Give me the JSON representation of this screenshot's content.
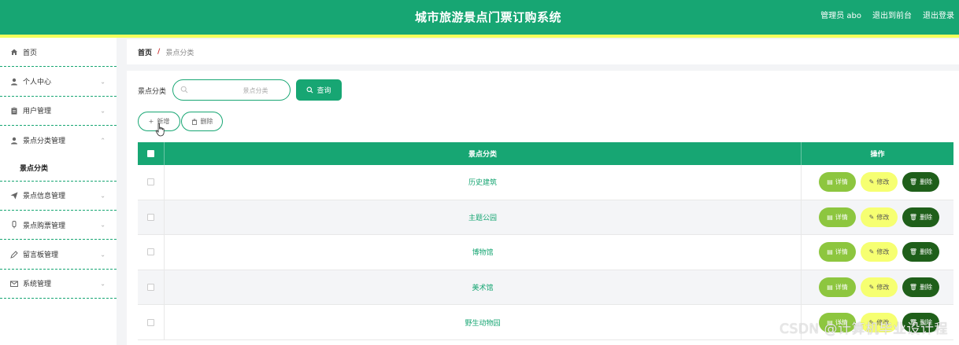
{
  "header": {
    "title": "城市旅游景点门票订购系统",
    "admin": "管理员 abo",
    "back_to_front": "退出到前台",
    "logout": "退出登录",
    "bg_color": "#17a673",
    "stripe_color": "#f2ff5b"
  },
  "sidebar": {
    "items": [
      {
        "label": "首页",
        "icon": "home-icon"
      },
      {
        "label": "个人中心",
        "icon": "user-icon"
      },
      {
        "label": "用户管理",
        "icon": "clipboard-icon"
      },
      {
        "label": "景点分类管理",
        "icon": "user-icon"
      },
      {
        "label": "景点信息管理",
        "icon": "send-icon"
      },
      {
        "label": "景点购票管理",
        "icon": "ticket-icon"
      },
      {
        "label": "留言板管理",
        "icon": "pen-icon"
      },
      {
        "label": "系统管理",
        "icon": "mail-icon"
      }
    ],
    "submenu_active": "景点分类"
  },
  "breadcrumb": {
    "home": "首页",
    "separator": "/",
    "current": "景点分类"
  },
  "search": {
    "label": "景点分类",
    "placeholder": "景点分类",
    "query_label": "查询"
  },
  "actions": {
    "add_label": "新增",
    "delete_label": "删除"
  },
  "table": {
    "col_name": "景点分类",
    "col_ops": "操作",
    "rows": [
      {
        "name": "历史建筑"
      },
      {
        "name": "主题公园"
      },
      {
        "name": "博物馆"
      },
      {
        "name": "美术馆"
      },
      {
        "name": "野生动物园"
      }
    ],
    "op_detail": "详情",
    "op_edit": "修改",
    "op_delete": "删除"
  },
  "watermark": "CSDN @计算机毕业设计程"
}
